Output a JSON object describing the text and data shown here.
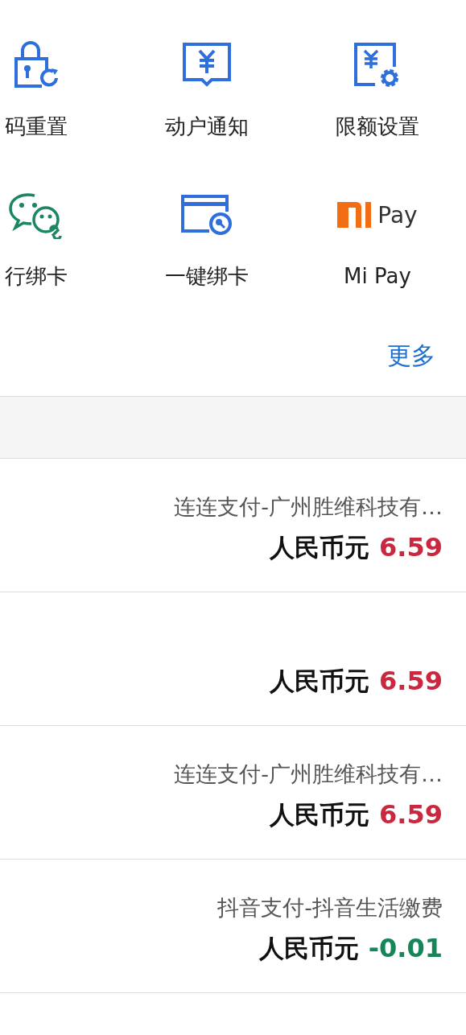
{
  "services": [
    {
      "kind": "lock",
      "label": "码重置"
    },
    {
      "kind": "notice",
      "label": "动户通知"
    },
    {
      "kind": "limit",
      "label": "限额设置"
    },
    {
      "kind": "wechat",
      "label": "行绑卡"
    },
    {
      "kind": "card",
      "label": "一键绑卡"
    },
    {
      "kind": "mipay",
      "logo_text": "Pay",
      "label": "Mi Pay"
    }
  ],
  "more": "更多",
  "transactions": [
    {
      "description": "连连支付-广州胜维科技有…",
      "currency": "人民币元",
      "amount": "6.59",
      "color": "#c9283e"
    },
    {
      "currency": "人民币元",
      "amount": "6.59",
      "color": "#c9283e"
    },
    {
      "description": "连连支付-广州胜维科技有…",
      "currency": "人民币元",
      "amount": "6.59",
      "color": "#c9283e"
    },
    {
      "description": "抖音支付-抖音生活缴费",
      "currency": "人民币元",
      "amount": "-0.01",
      "color": "#16865a"
    }
  ]
}
